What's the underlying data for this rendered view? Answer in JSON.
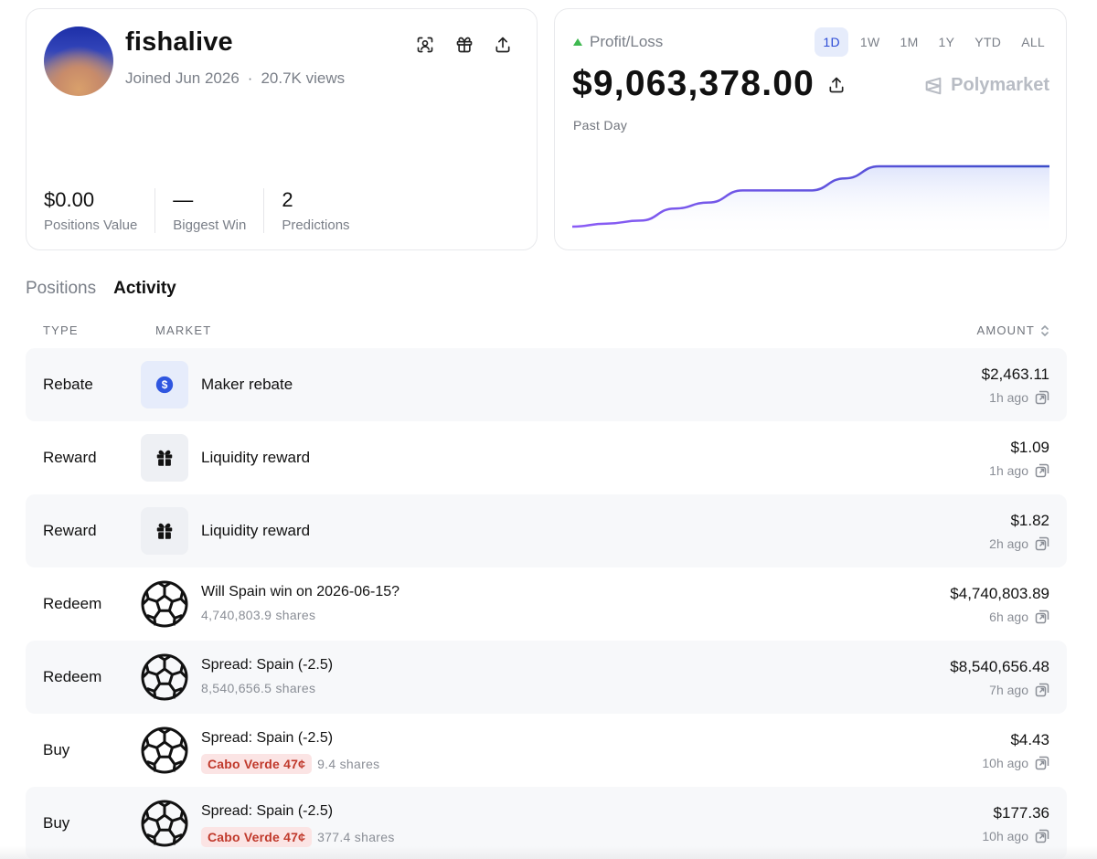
{
  "profile": {
    "username": "fishalive",
    "joined": "Joined Jun 2026",
    "separator": "·",
    "views": "20.7K views",
    "stats": [
      {
        "value": "$0.00",
        "label": "Positions Value"
      },
      {
        "value": "—",
        "label": "Biggest Win"
      },
      {
        "value": "2",
        "label": "Predictions"
      }
    ],
    "icons": [
      "scan-face-icon",
      "gift-icon",
      "share-icon"
    ]
  },
  "pnl": {
    "label": "Profit/Loss",
    "value": "$9,063,378.00",
    "period": "Past Day",
    "brand": "Polymarket",
    "ranges": [
      "1D",
      "1W",
      "1M",
      "1Y",
      "YTD",
      "ALL"
    ],
    "active_range": "1D",
    "colors": {
      "line_start": "#8b5cf6",
      "line_end": "#3b4cc8",
      "fill": "#dfe5fb",
      "up": "#3fb950"
    }
  },
  "chart_data": {
    "type": "line",
    "series": [
      {
        "values": [
          0,
          0.05,
          0.1,
          0.3,
          0.4,
          0.6,
          0.6,
          0.6,
          0.8,
          1.0,
          1.0,
          1.0,
          1.0,
          1.0,
          1.0
        ]
      }
    ],
    "title": "",
    "xlabel": "",
    "ylabel": "",
    "ylim": [
      0,
      1
    ],
    "grid": false
  },
  "tabs": [
    {
      "label": "Positions",
      "active": false
    },
    {
      "label": "Activity",
      "active": true
    }
  ],
  "table": {
    "headers": {
      "type": "TYPE",
      "market": "MARKET",
      "amount": "AMOUNT"
    },
    "rows": [
      {
        "type": "Rebate",
        "icon": "dollar-icon",
        "title": "Maker rebate",
        "sub": "",
        "pill": "",
        "amount": "$2,463.11",
        "time": "1h ago"
      },
      {
        "type": "Reward",
        "icon": "gift-icon",
        "title": "Liquidity reward",
        "sub": "",
        "pill": "",
        "amount": "$1.09",
        "time": "1h ago"
      },
      {
        "type": "Reward",
        "icon": "gift-icon",
        "title": "Liquidity reward",
        "sub": "",
        "pill": "",
        "amount": "$1.82",
        "time": "2h ago"
      },
      {
        "type": "Redeem",
        "icon": "soccer-ball-icon",
        "title": "Will Spain win on 2026-06-15?",
        "sub": "4,740,803.9 shares",
        "pill": "",
        "amount": "$4,740,803.89",
        "time": "6h ago"
      },
      {
        "type": "Redeem",
        "icon": "soccer-ball-icon",
        "title": "Spread: Spain (-2.5)",
        "sub": "8,540,656.5 shares",
        "pill": "",
        "amount": "$8,540,656.48",
        "time": "7h ago"
      },
      {
        "type": "Buy",
        "icon": "soccer-ball-icon",
        "title": "Spread: Spain (-2.5)",
        "sub": "9.4 shares",
        "pill": "Cabo Verde 47¢",
        "amount": "$4.43",
        "time": "10h ago"
      },
      {
        "type": "Buy",
        "icon": "soccer-ball-icon",
        "title": "Spread: Spain (-2.5)",
        "sub": "377.4 shares",
        "pill": "Cabo Verde 47¢",
        "amount": "$177.36",
        "time": "10h ago"
      }
    ]
  }
}
